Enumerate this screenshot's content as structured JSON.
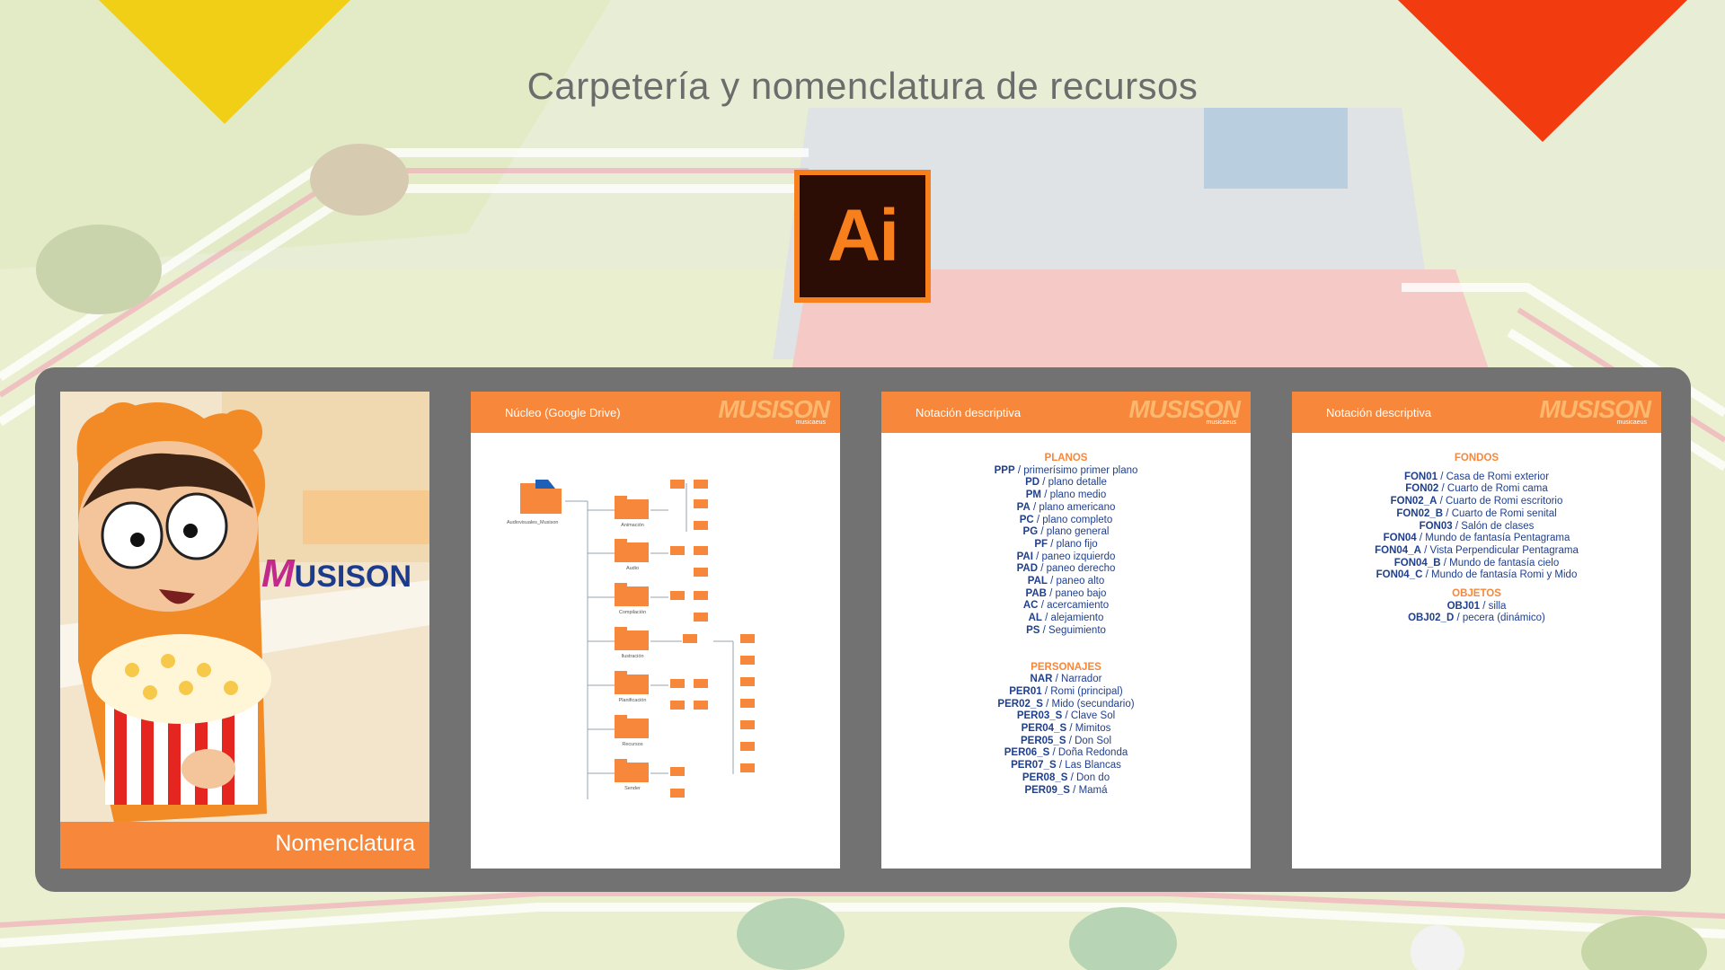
{
  "page": {
    "title": "Carpetería y nomenclatura de recursos"
  },
  "ai_logo": {
    "text": "Ai"
  },
  "colors": {
    "accent": "#f7873a",
    "brand_blue": "#1f3f8f",
    "triangle_yellow": "#f2cf17",
    "triangle_red": "#f23c10"
  },
  "cards": {
    "cover": {
      "label": "Nomenclatura",
      "logo_text": "USISON",
      "logo_m": "M"
    },
    "nucleo": {
      "header": "Núcleo (Google Drive)",
      "logo": "MUSISON",
      "logo_sub": "musicaeus",
      "root": "Audiovisuales_Musison",
      "folders": [
        "Animación",
        "Audio",
        "Compilación",
        "Ilustración",
        "Planificación",
        "Recursos",
        "Sender"
      ]
    },
    "notacion1": {
      "header": "Notación descriptiva",
      "logo": "MUSISON",
      "logo_sub": "musicaeus",
      "planos_title": "PLANOS",
      "planos": [
        {
          "code": "PPP",
          "desc": "primerísimo primer plano"
        },
        {
          "code": "PD",
          "desc": "plano detalle"
        },
        {
          "code": "PM",
          "desc": "plano medio"
        },
        {
          "code": "PA",
          "desc": "plano americano"
        },
        {
          "code": "PC",
          "desc": "plano completo"
        },
        {
          "code": "PG",
          "desc": "plano general"
        },
        {
          "code": "PF",
          "desc": "plano fijo"
        },
        {
          "code": "PAI",
          "desc": "paneo izquierdo"
        },
        {
          "code": "PAD",
          "desc": "paneo derecho"
        },
        {
          "code": "PAL",
          "desc": "paneo alto"
        },
        {
          "code": "PAB",
          "desc": "paneo bajo"
        },
        {
          "code": "AC",
          "desc": "acercamiento"
        },
        {
          "code": "AL",
          "desc": "alejamiento"
        },
        {
          "code": "PS",
          "desc": "Seguimiento"
        }
      ],
      "personajes_title": "PERSONAJES",
      "personajes": [
        {
          "code": "NAR",
          "desc": "Narrador"
        },
        {
          "code": "PER01",
          "desc": "Romi (principal)"
        },
        {
          "code": "PER02_S",
          "desc": "Mido (secundario)"
        },
        {
          "code": "PER03_S",
          "desc": "Clave Sol"
        },
        {
          "code": "PER04_S",
          "desc": "Mimitos"
        },
        {
          "code": "PER05_S",
          "desc": "Don Sol"
        },
        {
          "code": "PER06_S",
          "desc": "Doña Redonda"
        },
        {
          "code": "PER07_S",
          "desc": "Las Blancas"
        },
        {
          "code": "PER08_S",
          "desc": "Don do"
        },
        {
          "code": "PER09_S",
          "desc": "Mamá"
        }
      ]
    },
    "notacion2": {
      "header": "Notación descriptiva",
      "logo": "MUSISON",
      "logo_sub": "musicaeus",
      "fondos_title": "FONDOS",
      "fondos": [
        {
          "code": "FON01",
          "desc": "Casa de Romi exterior"
        },
        {
          "code": "FON02",
          "desc": "Cuarto de Romi cama"
        },
        {
          "code": "FON02_A",
          "desc": "Cuarto de Romi escritorio"
        },
        {
          "code": "FON02_B",
          "desc": "Cuarto de Romi senital"
        },
        {
          "code": "FON03",
          "desc": "Salón de clases"
        },
        {
          "code": "FON04",
          "desc": "Mundo de fantasía Pentagrama"
        },
        {
          "code": "FON04_A",
          "desc": "Vista Perpendicular Pentagrama"
        },
        {
          "code": "FON04_B",
          "desc": "Mundo de fantasía cielo"
        },
        {
          "code": "FON04_C",
          "desc": "Mundo de fantasía  Romi y Mido"
        }
      ],
      "objetos_title": "OBJETOS",
      "objetos": [
        {
          "code": "OBJ01",
          "desc": "silla"
        },
        {
          "code": "OBJ02_D",
          "desc": "pecera (dinámico)"
        }
      ]
    }
  }
}
